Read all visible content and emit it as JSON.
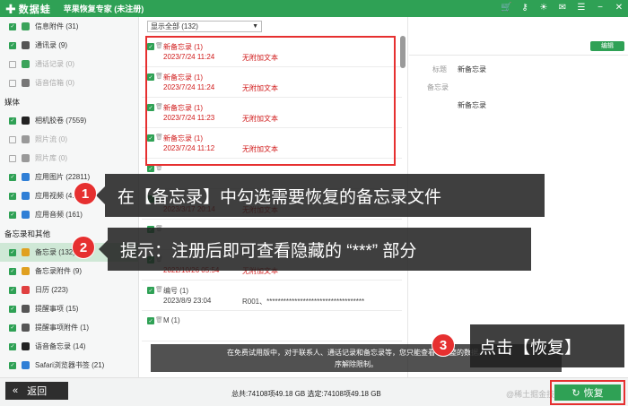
{
  "titlebar": {
    "logo_text": "数据蛙",
    "app_title": "苹果恢复专家 (未注册)"
  },
  "sidebar": {
    "items_top": [
      {
        "label": "信息附件 (31)",
        "checked": true,
        "disabled": false,
        "icon": "message-attachment-icon",
        "color": "#3aa35a"
      },
      {
        "label": "通讯录 (9)",
        "checked": true,
        "disabled": false,
        "icon": "contacts-icon",
        "color": "#555555"
      },
      {
        "label": "通话记录 (0)",
        "checked": false,
        "disabled": true,
        "icon": "call-log-icon",
        "color": "#3aa35a"
      },
      {
        "label": "语音信箱 (0)",
        "checked": false,
        "disabled": true,
        "icon": "voicemail-icon",
        "color": "#777777"
      }
    ],
    "section_media": "媒体",
    "items_media": [
      {
        "label": "相机胶卷 (7559)",
        "checked": true,
        "disabled": false,
        "icon": "camera-roll-icon",
        "color": "#222222"
      },
      {
        "label": "照片流 (0)",
        "checked": false,
        "disabled": true,
        "icon": "photo-stream-icon",
        "color": "#999999"
      },
      {
        "label": "照片库 (0)",
        "checked": false,
        "disabled": true,
        "icon": "photo-library-icon",
        "color": "#999999"
      },
      {
        "label": "应用图片 (22811)",
        "checked": true,
        "disabled": false,
        "icon": "app-photos-icon",
        "color": "#2f7fd6"
      },
      {
        "label": "应用视频 (4...",
        "checked": true,
        "disabled": false,
        "icon": "app-videos-icon",
        "color": "#2f7fd6"
      },
      {
        "label": "应用音频 (161)",
        "checked": true,
        "disabled": false,
        "icon": "app-audio-icon",
        "color": "#2f7fd6"
      }
    ],
    "section_notes": "备忘录和其他",
    "items_notes": [
      {
        "label": "备忘录 (132)",
        "checked": true,
        "disabled": false,
        "selected": true,
        "icon": "notes-icon",
        "color": "#e0a020"
      },
      {
        "label": "备忘录附件 (9)",
        "checked": true,
        "disabled": false,
        "icon": "notes-attachment-icon",
        "color": "#e0a020"
      },
      {
        "label": "日历 (223)",
        "checked": true,
        "disabled": false,
        "icon": "calendar-icon",
        "color": "#e04040"
      },
      {
        "label": "提醒事项 (15)",
        "checked": true,
        "disabled": false,
        "icon": "reminders-icon",
        "color": "#555555"
      },
      {
        "label": "提醒事项附件 (1)",
        "checked": true,
        "disabled": false,
        "icon": "reminder-attachment-icon",
        "color": "#555555"
      },
      {
        "label": "语音备忘录 (14)",
        "checked": true,
        "disabled": false,
        "icon": "voice-memo-icon",
        "color": "#222222"
      },
      {
        "label": "Safari浏览器书签 (21)",
        "checked": true,
        "disabled": false,
        "icon": "safari-bookmark-icon",
        "color": "#2f7fd6"
      }
    ]
  },
  "list": {
    "filter_value": "显示全部 (132)",
    "items": [
      {
        "title": "新备忘录 (1)",
        "date": "2023/7/24 11:24",
        "extra": "无附加文本",
        "checked": true,
        "red": true
      },
      {
        "title": "新备忘录 (1)",
        "date": "2023/7/24 11:24",
        "extra": "无附加文本",
        "checked": true,
        "red": true
      },
      {
        "title": "新备忘录 (1)",
        "date": "2023/7/24 11:23",
        "extra": "无附加文本",
        "checked": true,
        "red": true
      },
      {
        "title": "新备忘录 (1)",
        "date": "2023/7/24 11:12",
        "extra": "无附加文本",
        "checked": true,
        "red": true
      },
      {
        "title": "",
        "date": "",
        "extra": "",
        "checked": true,
        "red": false
      },
      {
        "title": "",
        "date": "2023/3/17 20:14",
        "extra": "无附加文本",
        "checked": true,
        "red": true
      },
      {
        "title": "",
        "date": "",
        "extra": "",
        "checked": true,
        "red": false
      },
      {
        "title": "",
        "date": "2022/10/26 05:54",
        "extra": "无附加文本",
        "checked": true,
        "red": true
      },
      {
        "title": "编号 (1)",
        "date": "2023/8/9 23:04",
        "extra": "R001、***********************************",
        "checked": true,
        "red": false
      },
      {
        "title": "M (1)",
        "date": "",
        "extra": "",
        "checked": true,
        "red": false
      }
    ]
  },
  "detail": {
    "edit_label": "编辑",
    "title_label": "标题",
    "title_value": "新备忘录",
    "notes_label": "备忘录",
    "body_value": "新备忘录"
  },
  "callouts": {
    "step1_num": "1",
    "step1_text": "在【备忘录】中勾选需要恢复的备忘录文件",
    "step2_num": "2",
    "step2_text": "提示：注册后即可查看隐藏的 “***” 部分",
    "step3_num": "3",
    "step3_text": "点击【恢复】"
  },
  "notice": {
    "line1": "在免费试用版中，对于联系人、通话记录和备忘录等，您只能查看不完整的数据。",
    "line2": "序解除限制。"
  },
  "bottombar": {
    "back_label": "返回",
    "status_text": "总共:74108项49.18 GB 选定:74108项49.18 GB",
    "watermark": "@稀土掘金技术社区",
    "restore_label": "恢复"
  },
  "colors": {
    "brand_green": "#2fa155",
    "highlight_red": "#e63030",
    "record_red": "#d01818"
  }
}
